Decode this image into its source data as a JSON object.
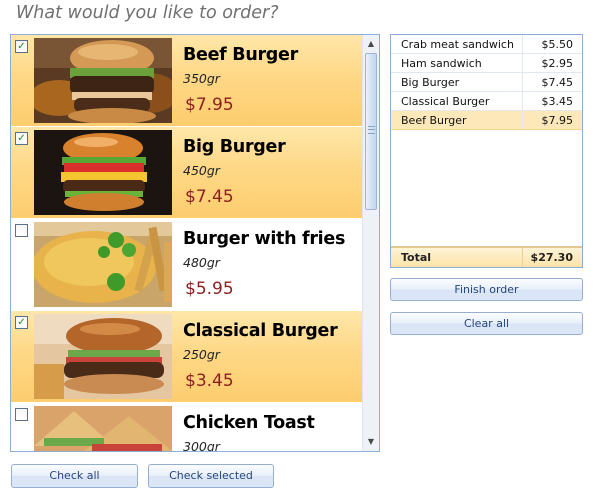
{
  "heading": "What would you like to order?",
  "colors": {
    "selected_row": "#fdd27c",
    "price_text": "#8b1f1f",
    "border": "#8daed7",
    "button_text": "#25467a"
  },
  "products": [
    {
      "name": "Beef Burger",
      "weight": "350gr",
      "price": "$7.95",
      "checked": true,
      "image": "beef-burger-photo"
    },
    {
      "name": "Big Burger",
      "weight": "450gr",
      "price": "$7.45",
      "checked": true,
      "image": "big-burger-photo"
    },
    {
      "name": "Burger with fries",
      "weight": "480gr",
      "price": "$5.95",
      "checked": false,
      "image": "burger-with-fries-photo"
    },
    {
      "name": "Classical Burger",
      "weight": "250gr",
      "price": "$3.45",
      "checked": true,
      "image": "classical-burger-photo"
    },
    {
      "name": "Chicken Toast",
      "weight": "300gr",
      "price": "",
      "checked": false,
      "image": "chicken-toast-photo"
    }
  ],
  "buttons": {
    "check_all": "Check all",
    "check_selected": "Check selected",
    "finish_order": "Finish order",
    "clear_all": "Clear all"
  },
  "order": {
    "items": [
      {
        "name": "Crab meat sandwich",
        "price": "$5.50",
        "selected": false
      },
      {
        "name": "Ham sandwich",
        "price": "$2.95",
        "selected": false
      },
      {
        "name": "Big Burger",
        "price": "$7.45",
        "selected": false
      },
      {
        "name": "Classical Burger",
        "price": "$3.45",
        "selected": false
      },
      {
        "name": "Beef Burger",
        "price": "$7.95",
        "selected": true
      }
    ],
    "total_label": "Total",
    "total_value": "$27.30"
  }
}
